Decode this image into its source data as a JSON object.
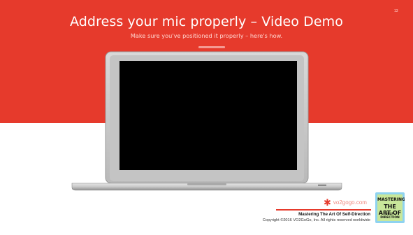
{
  "slide": {
    "title": "Address your mic properly – Video Demo",
    "subtitle": "Make sure you've positioned it properly – here's how.",
    "page_number": "13"
  },
  "footer": {
    "brand": "vo2gogo.com",
    "course_title": "Mastering The Art Of Self-Direction",
    "copyright": "Copyright ©2016 VO2GoGo, Inc. All rights reserved worldwide",
    "logo_icon": "asterisk-star-icon"
  },
  "book_logo": {
    "line1": "MASTERING",
    "line2": "THE ART OF",
    "line3": "SELF-DIRECTION"
  },
  "colors": {
    "accent": "#e63a2c",
    "background": "#ffffff",
    "screen": "#000000"
  }
}
